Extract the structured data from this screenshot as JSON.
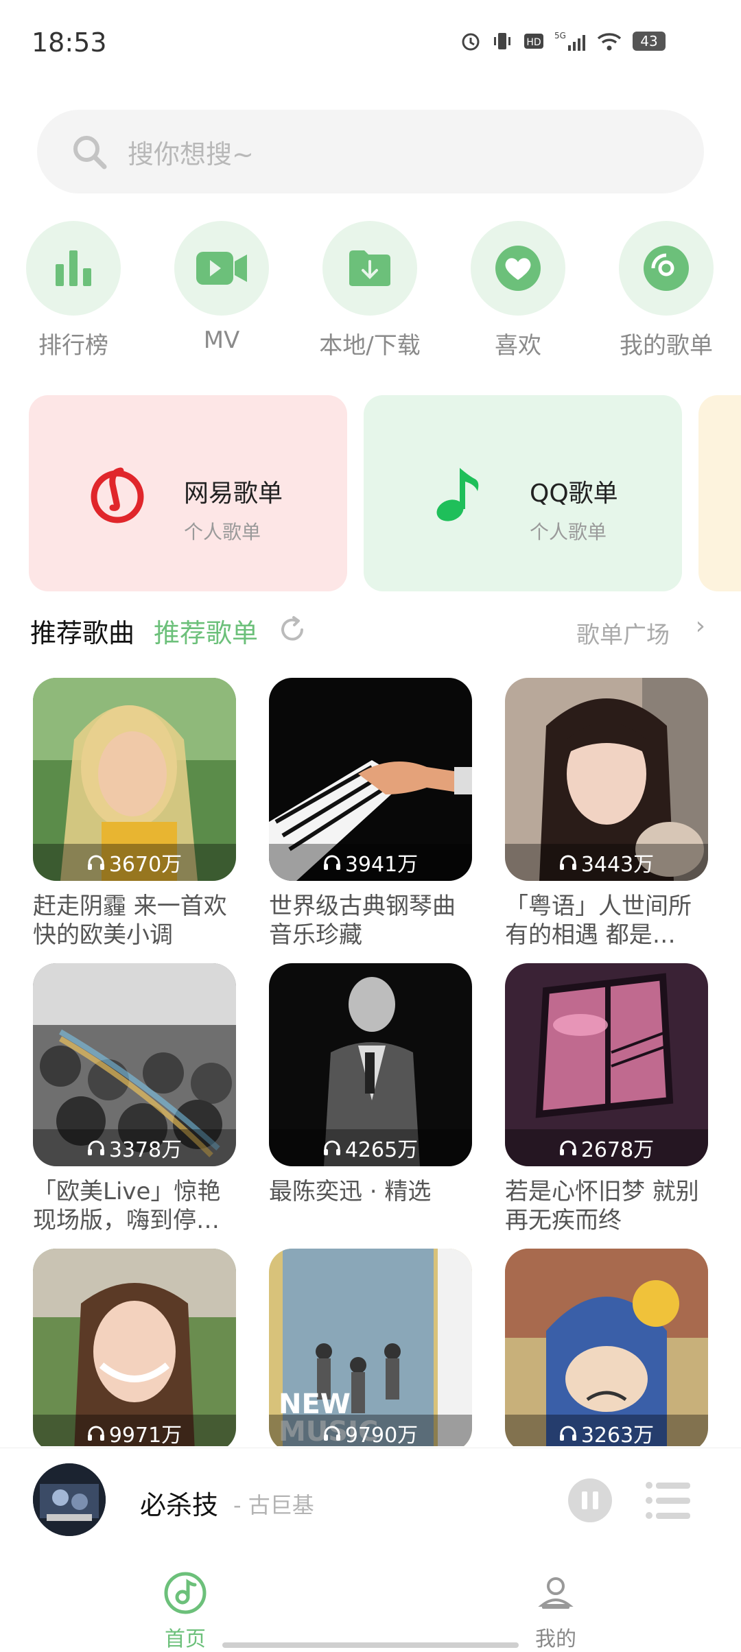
{
  "status": {
    "time": "18:53",
    "battery": "43",
    "network": "5G"
  },
  "search": {
    "placeholder": "搜你想搜~"
  },
  "quick": [
    {
      "label": "排行榜",
      "icon": "chart-icon"
    },
    {
      "label": "MV",
      "icon": "video-icon"
    },
    {
      "label": "本地/下载",
      "icon": "download-folder-icon"
    },
    {
      "label": "喜欢",
      "icon": "heart-icon"
    },
    {
      "label": "我的歌单",
      "icon": "disc-icon"
    }
  ],
  "cards": [
    {
      "title": "网易歌单",
      "sub": "个人歌单",
      "color": "#fde6e6"
    },
    {
      "title": "QQ歌单",
      "sub": "个人歌单",
      "color": "#e6f6ea"
    }
  ],
  "tabs": {
    "songs": "推荐歌曲",
    "playlists": "推荐歌单",
    "square": "歌单广场"
  },
  "playlists": [
    {
      "count": "3670万",
      "name": "赶走阴霾 来一首欢快的欧美小调"
    },
    {
      "count": "3941万",
      "name": "世界级古典钢琴曲音乐珍藏"
    },
    {
      "count": "3443万",
      "name": "「粤语」人世间所有的相遇 都是…"
    },
    {
      "count": "3378万",
      "name": "「欧美Live」惊艳现场版，嗨到停…"
    },
    {
      "count": "4265万",
      "name": "最陈奕迅 · 精选"
    },
    {
      "count": "2678万",
      "name": "若是心怀旧梦 就别再无疾而终"
    },
    {
      "count": "9971万",
      "name": ""
    },
    {
      "count": "9790万",
      "name": ""
    },
    {
      "count": "3263万",
      "name": ""
    }
  ],
  "player": {
    "song": "必杀技",
    "artist": "- 古巨基"
  },
  "nav": {
    "home": "首页",
    "mine": "我的"
  },
  "colors": {
    "accent": "#6cc07a",
    "netease": "#e0262b",
    "qq": "#1fbf5a"
  }
}
